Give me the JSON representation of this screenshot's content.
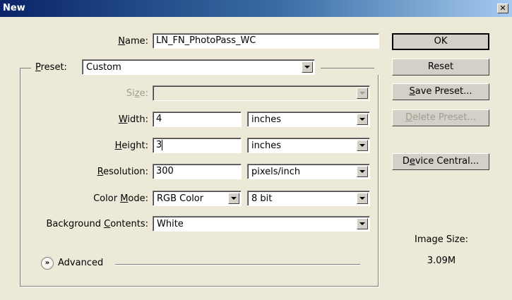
{
  "window": {
    "title": "New",
    "close_glyph": "✕"
  },
  "form": {
    "name": {
      "label_pre": "",
      "label_ul": "N",
      "label_post": "ame:",
      "value": "LN_FN_PhotoPass_WC"
    },
    "preset": {
      "label_pre": "",
      "label_ul": "P",
      "label_post": "reset:",
      "value": "Custom"
    },
    "size": {
      "label_pre": "Si",
      "label_ul": "z",
      "label_post": "e:",
      "value": ""
    },
    "width": {
      "label_pre": "",
      "label_ul": "W",
      "label_post": "idth:",
      "value": "4",
      "unit": "inches"
    },
    "height": {
      "label_pre": "",
      "label_ul": "H",
      "label_post": "eight:",
      "value": "3",
      "unit": "inches"
    },
    "resolution": {
      "label_pre": "",
      "label_ul": "R",
      "label_post": "esolution:",
      "value": "300",
      "unit": "pixels/inch"
    },
    "color_mode": {
      "label_pre": "Color ",
      "label_ul": "M",
      "label_post": "ode:",
      "value": "RGB Color",
      "bit_depth": "8 bit"
    },
    "background": {
      "label_pre": "Background ",
      "label_ul": "C",
      "label_post": "ontents:",
      "value": "White"
    },
    "advanced": {
      "label": "Advanced",
      "icon": "»"
    }
  },
  "buttons": {
    "ok": {
      "pre": "OK",
      "ul": "",
      "post": ""
    },
    "reset": {
      "pre": "Reset",
      "ul": "",
      "post": ""
    },
    "save_preset": {
      "pre": "",
      "ul": "S",
      "post": "ave Preset..."
    },
    "delete_preset": {
      "pre": "",
      "ul": "D",
      "post": "elete Preset..."
    },
    "device_central": {
      "pre": "D",
      "ul": "e",
      "post": "vice Central..."
    }
  },
  "image_size": {
    "label": "Image Size:",
    "value": "3.09M"
  }
}
